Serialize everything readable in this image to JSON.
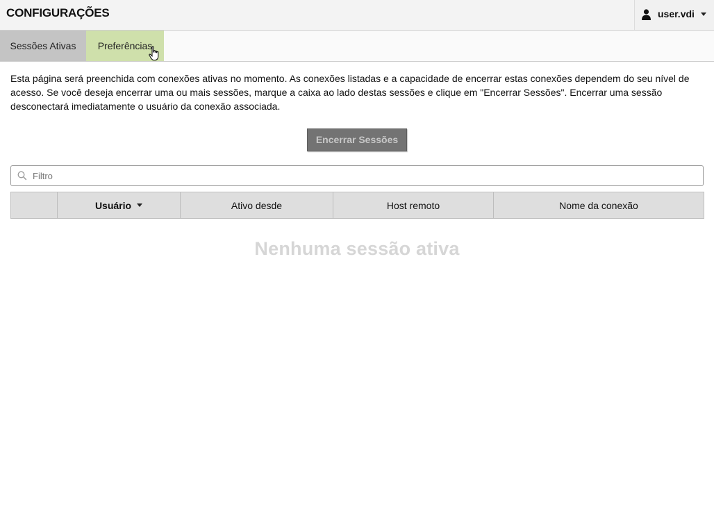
{
  "header": {
    "title": "CONFIGURAÇÕES",
    "user": {
      "name": "user.vdi",
      "icon": "user-icon"
    }
  },
  "tabs": [
    {
      "label": "Sessões Ativas"
    },
    {
      "label": "Preferências"
    }
  ],
  "description": "Esta página será preenchida com conexões ativas no momento. As conexões listadas e a capacidade de encerrar estas conexões dependem do seu nível de acesso. Se você deseja encerrar uma ou mais sessões, marque a caixa ao lado destas sessões e clique em \"Encerrar Sessões\". Encerrar uma sessão desconectará imediatamente o usuário da conexão associada.",
  "actions": {
    "end_sessions": "Encerrar Sessões"
  },
  "filter": {
    "placeholder": "Filtro",
    "value": ""
  },
  "table": {
    "columns": [
      "",
      "Usuário",
      "Ativo desde",
      "Host remoto",
      "Nome da conexão"
    ],
    "sorted_by": "Usuário",
    "rows": []
  },
  "empty_message": "Nenhuma sessão ativa",
  "colors": {
    "active_tab": "#c4c4c4",
    "hover_tab": "#cfe0ab",
    "button_bg": "#737373"
  }
}
